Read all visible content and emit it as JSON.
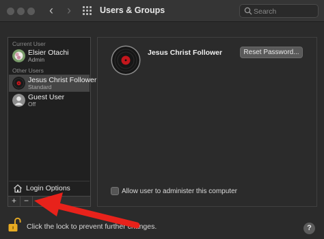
{
  "window": {
    "title": "Users & Groups",
    "nav_back": "‹",
    "nav_forward": "›"
  },
  "search": {
    "placeholder": "Search",
    "value": ""
  },
  "sidebar": {
    "current_user_header": "Current User",
    "other_users_header": "Other Users",
    "users": [
      {
        "name": "Elsier Otachi",
        "role": "Admin"
      },
      {
        "name": "Jesus Christ Follower",
        "role": "Standard"
      },
      {
        "name": "Guest User",
        "role": "Off"
      }
    ],
    "login_options_label": "Login Options",
    "add_label": "+",
    "remove_label": "−"
  },
  "detail": {
    "user_name": "Jesus Christ Follower",
    "reset_password_label": "Reset Password...",
    "admin_checkbox_label": "Allow user to administer this computer",
    "admin_checked": false
  },
  "footer": {
    "lock_text": "Click the lock to prevent further changes.",
    "help_label": "?"
  },
  "colors": {
    "annotation_arrow": "#e8221b",
    "selected_row": "#464646",
    "background": "#2b2b2b"
  }
}
